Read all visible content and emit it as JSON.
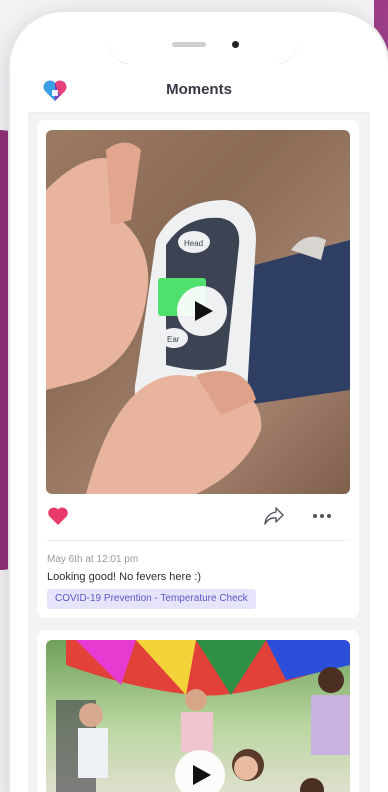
{
  "header": {
    "title": "Moments",
    "logo_icon": "heart-logo-icon"
  },
  "post": {
    "liked": true,
    "timestamp": "May 6th at 12:01 pm",
    "caption": "Looking good! No fevers here :)",
    "tag": "COVID-19 Prevention - Temperature Check",
    "media_type": "video"
  },
  "next_post": {
    "media_type": "video"
  },
  "colors": {
    "accent_heart": "#e83a6a",
    "tag_bg": "#e6e4fb",
    "tag_text": "#5a56c7",
    "background_magenta": "#a9438f"
  }
}
